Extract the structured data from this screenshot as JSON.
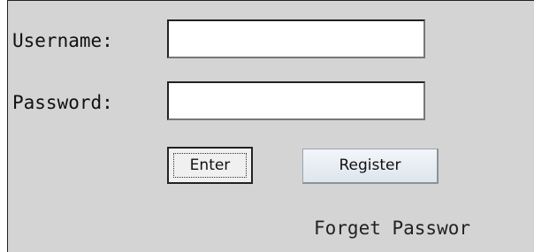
{
  "login_form": {
    "username_label": "Username:",
    "username_value": "",
    "password_label": "Password:",
    "password_value": "",
    "enter_label": "Enter",
    "register_label": "Register",
    "forgot_password_label": "Forget Passwor"
  },
  "colors": {
    "panel_background": "#d4d4d4",
    "field_background": "#ffffff",
    "register_button_background": "#e6ecf2"
  }
}
